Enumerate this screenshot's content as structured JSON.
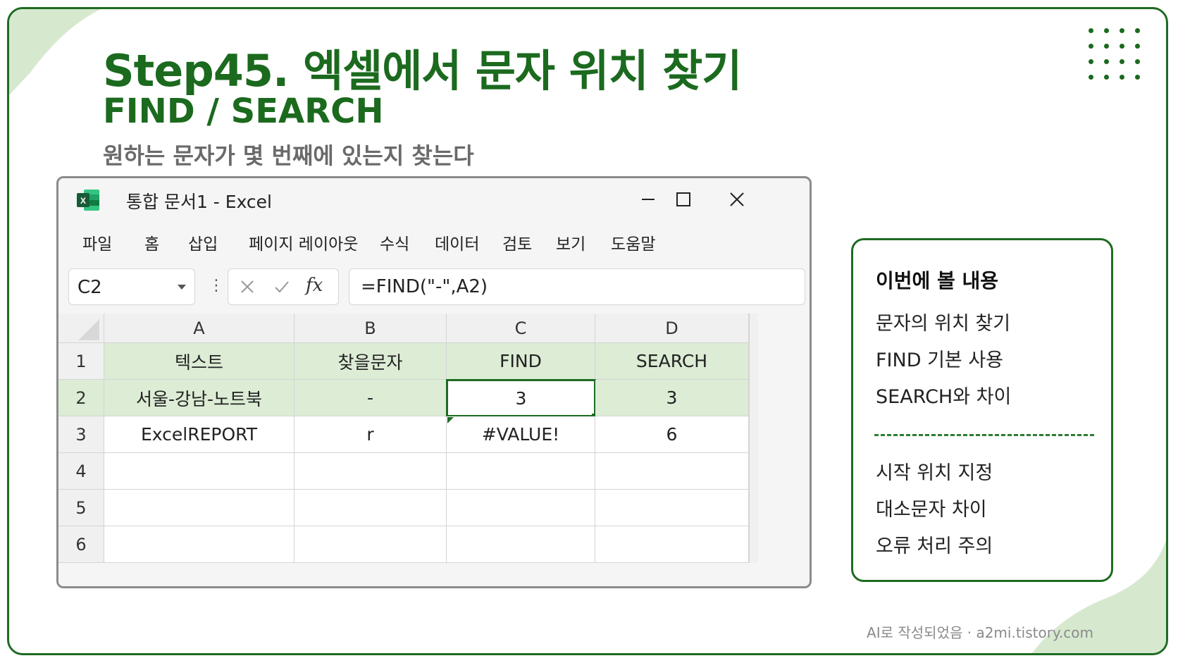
{
  "slide": {
    "title": "Step45. 엑셀에서 문자 위치 찾기",
    "subtitle": "FIND  /  SEARCH",
    "description": "원하는 문자가 몇 번째에 있는지 찾는다",
    "footer": "AI로 작성되었음 · a2mi.tistory.com",
    "accent_color": "#1e6b22",
    "leaf_color": "#d6e9cf"
  },
  "window": {
    "title": "통합 문서1 - Excel",
    "icons": [
      "excel-logo-icon",
      "minimize-icon",
      "maximize-icon",
      "close-icon"
    ]
  },
  "menu": [
    "파일",
    "홈",
    "삽입",
    "페이지 레이아웃",
    "수식",
    "데이터",
    "검토",
    "보기",
    "도움말"
  ],
  "formula_bar": {
    "name_box": "C2",
    "formula": "=FIND(\"-\",A2)",
    "fx_label": "fx"
  },
  "sheet": {
    "columns": [
      "A",
      "B",
      "C",
      "D"
    ],
    "rows": [
      "1",
      "2",
      "3",
      "4",
      "5",
      "6"
    ],
    "cells": [
      [
        "텍스트",
        "찾을문자",
        "FIND",
        "SEARCH"
      ],
      [
        "서울-강남-노트북",
        "-",
        "3",
        "3"
      ],
      [
        "ExcelREPORT",
        "r",
        "#VALUE!",
        "6"
      ],
      [
        "",
        "",
        "",
        ""
      ],
      [
        "",
        "",
        "",
        ""
      ],
      [
        "",
        "",
        "",
        ""
      ]
    ],
    "selected_cell": "C2",
    "header_fill": "#dcecd5"
  },
  "panel": {
    "title": "이번에 볼 내용",
    "items_top": [
      "문자의 위치 찾기",
      "FIND 기본 사용",
      "SEARCH와 차이"
    ],
    "items_bottom": [
      "시작 위치 지정",
      "대소문자 차이",
      "오류 처리 주의"
    ]
  }
}
